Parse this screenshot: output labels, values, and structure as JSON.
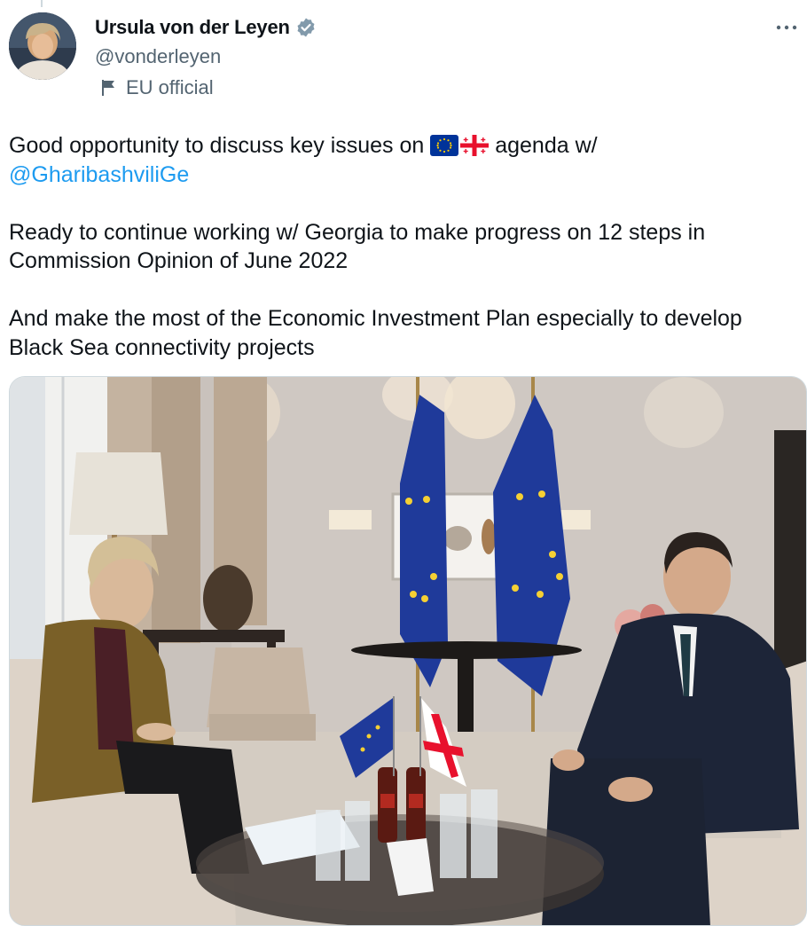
{
  "author": {
    "name": "Ursula von der Leyen",
    "handle": "@vonderleyen",
    "affiliation": "EU official",
    "verified_icon": "verified-badge-icon",
    "affiliation_icon": "flag-icon"
  },
  "menu": {
    "icon": "more-icon"
  },
  "tweet": {
    "line1_before": "Good opportunity to discuss key issues on ",
    "flag1": "EU flag emoji",
    "flag2": "Georgia flag emoji",
    "line1_after": " agenda w/",
    "mention": "@GharibashviliGe",
    "para2": "Ready to continue working w/ Georgia to make progress on 12 steps in Commission Opinion of June 2022",
    "para3": "And make the most of the Economic Investment Plan especially to develop Black Sea connectivity projects"
  },
  "media": {
    "kind": "photo"
  },
  "colors": {
    "text": "#0f1419",
    "secondary": "#536471",
    "link": "#1d9bf0",
    "eu_blue": "#003399",
    "eu_gold": "#ffcc00",
    "georgia_red": "#e8112d"
  }
}
